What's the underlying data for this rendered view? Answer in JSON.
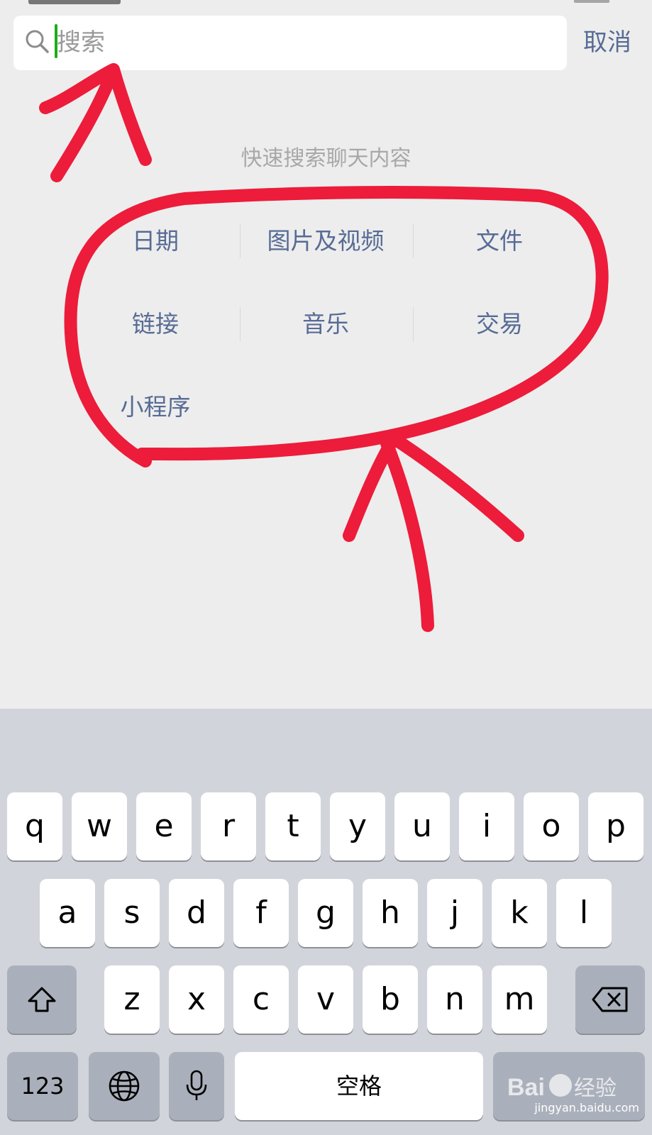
{
  "search": {
    "placeholder": "搜索",
    "cancel_label": "取消",
    "hint": "快速搜索聊天内容"
  },
  "categories": [
    {
      "label": "日期"
    },
    {
      "label": "图片及视频"
    },
    {
      "label": "文件"
    },
    {
      "label": "链接"
    },
    {
      "label": "音乐"
    },
    {
      "label": "交易"
    },
    {
      "label": "小程序"
    }
  ],
  "keyboard": {
    "row1": [
      "q",
      "w",
      "e",
      "r",
      "t",
      "y",
      "u",
      "i",
      "o",
      "p"
    ],
    "row2": [
      "a",
      "s",
      "d",
      "f",
      "g",
      "h",
      "j",
      "k",
      "l"
    ],
    "row3": [
      "z",
      "x",
      "c",
      "v",
      "b",
      "n",
      "m"
    ],
    "numbers_label": "123",
    "space_label": "空格"
  },
  "watermark": {
    "brand": "Bai du 经验",
    "url": "jingyan.baidu.com"
  },
  "colors": {
    "accent": "#576b95",
    "cursor": "#1aad19",
    "annotation": "#ec1c3a"
  }
}
